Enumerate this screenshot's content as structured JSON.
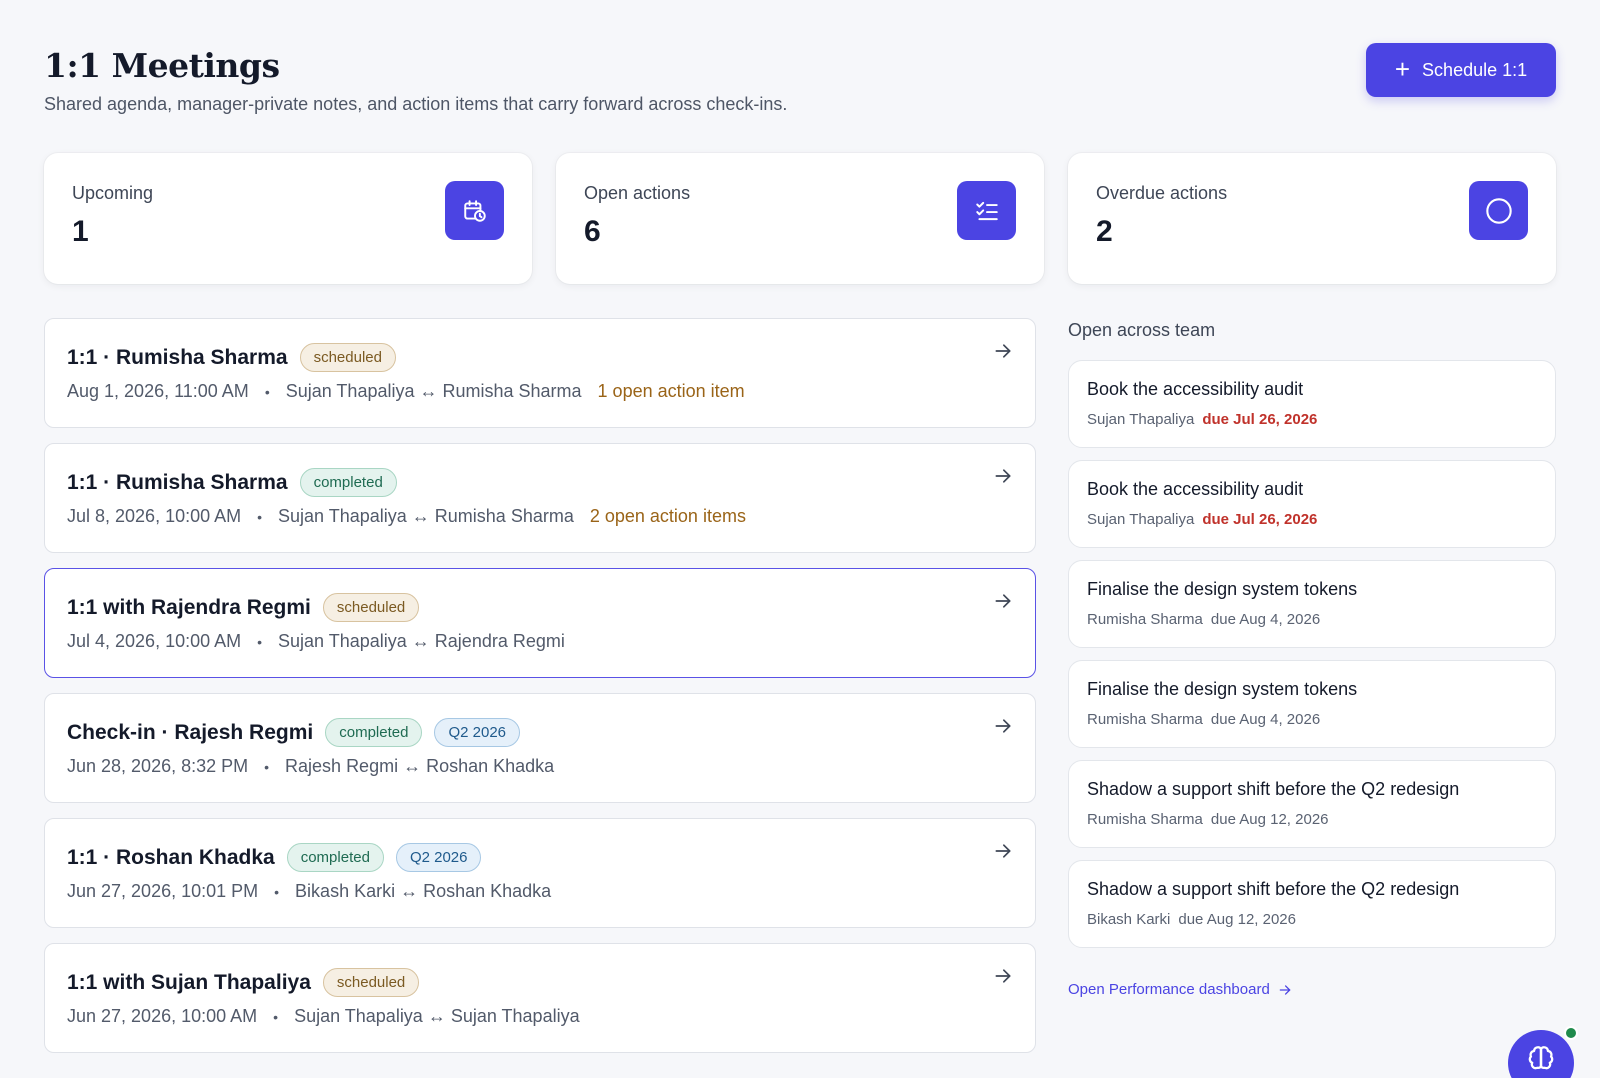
{
  "header": {
    "title": "1:1 Meetings",
    "subtitle": "Shared agenda, manager-private notes, and action items that carry forward across check-ins.",
    "schedule_button": "Schedule 1:1"
  },
  "stats": [
    {
      "label": "Upcoming",
      "value": "1",
      "icon": "calendar-clock-icon"
    },
    {
      "label": "Open actions",
      "value": "6",
      "icon": "list-checks-icon"
    },
    {
      "label": "Overdue actions",
      "value": "2",
      "icon": "circle-icon"
    }
  ],
  "meetings": [
    {
      "title": "1:1 · Rumisha Sharma",
      "badges": [
        {
          "text": "scheduled",
          "kind": "scheduled"
        }
      ],
      "datetime": "Aug 1, 2026, 11:00 AM",
      "participants": "Sujan Thapaliya ↔ Rumisha Sharma",
      "open_items": "1 open action item",
      "selected": false
    },
    {
      "title": "1:1 · Rumisha Sharma",
      "badges": [
        {
          "text": "completed",
          "kind": "completed"
        }
      ],
      "datetime": "Jul 8, 2026, 10:00 AM",
      "participants": "Sujan Thapaliya ↔ Rumisha Sharma",
      "open_items": "2 open action items",
      "selected": false
    },
    {
      "title": "1:1 with Rajendra Regmi",
      "badges": [
        {
          "text": "scheduled",
          "kind": "scheduled"
        }
      ],
      "datetime": "Jul 4, 2026, 10:00 AM",
      "participants": "Sujan Thapaliya ↔ Rajendra Regmi",
      "open_items": "",
      "selected": true
    },
    {
      "title": "Check-in · Rajesh Regmi",
      "badges": [
        {
          "text": "completed",
          "kind": "completed"
        },
        {
          "text": "Q2 2026",
          "kind": "quarter"
        }
      ],
      "datetime": "Jun 28, 2026, 8:32 PM",
      "participants": "Rajesh Regmi ↔ Roshan Khadka",
      "open_items": "",
      "selected": false
    },
    {
      "title": "1:1 · Roshan Khadka",
      "badges": [
        {
          "text": "completed",
          "kind": "completed"
        },
        {
          "text": "Q2 2026",
          "kind": "quarter"
        }
      ],
      "datetime": "Jun 27, 2026, 10:01 PM",
      "participants": "Bikash Karki ↔ Roshan Khadka",
      "open_items": "",
      "selected": false
    },
    {
      "title": "1:1 with Sujan Thapaliya",
      "badges": [
        {
          "text": "scheduled",
          "kind": "scheduled"
        }
      ],
      "datetime": "Jun 27, 2026, 10:00 AM",
      "participants": "Sujan Thapaliya ↔ Sujan Thapaliya",
      "open_items": "",
      "selected": false
    }
  ],
  "side_panel": {
    "heading": "Open across team",
    "actions": [
      {
        "title": "Book the accessibility audit",
        "owner": "Sujan Thapaliya",
        "due": "due Jul 26, 2026",
        "overdue": true
      },
      {
        "title": "Book the accessibility audit",
        "owner": "Sujan Thapaliya",
        "due": "due Jul 26, 2026",
        "overdue": true
      },
      {
        "title": "Finalise the design system tokens",
        "owner": "Rumisha Sharma",
        "due": "due Aug 4, 2026",
        "overdue": false
      },
      {
        "title": "Finalise the design system tokens",
        "owner": "Rumisha Sharma",
        "due": "due Aug 4, 2026",
        "overdue": false
      },
      {
        "title": "Shadow a support shift before the Q2 redesign",
        "owner": "Rumisha Sharma",
        "due": "due Aug 12, 2026",
        "overdue": false
      },
      {
        "title": "Shadow a support shift before the Q2 redesign",
        "owner": "Bikash Karki",
        "due": "due Aug 12, 2026",
        "overdue": false
      }
    ],
    "dashboard_link": "Open Performance dashboard"
  },
  "colors": {
    "accent": "#4b44e3",
    "overdue": "#c0322b",
    "open_items": "#9a6418",
    "online": "#1f8a4c"
  }
}
